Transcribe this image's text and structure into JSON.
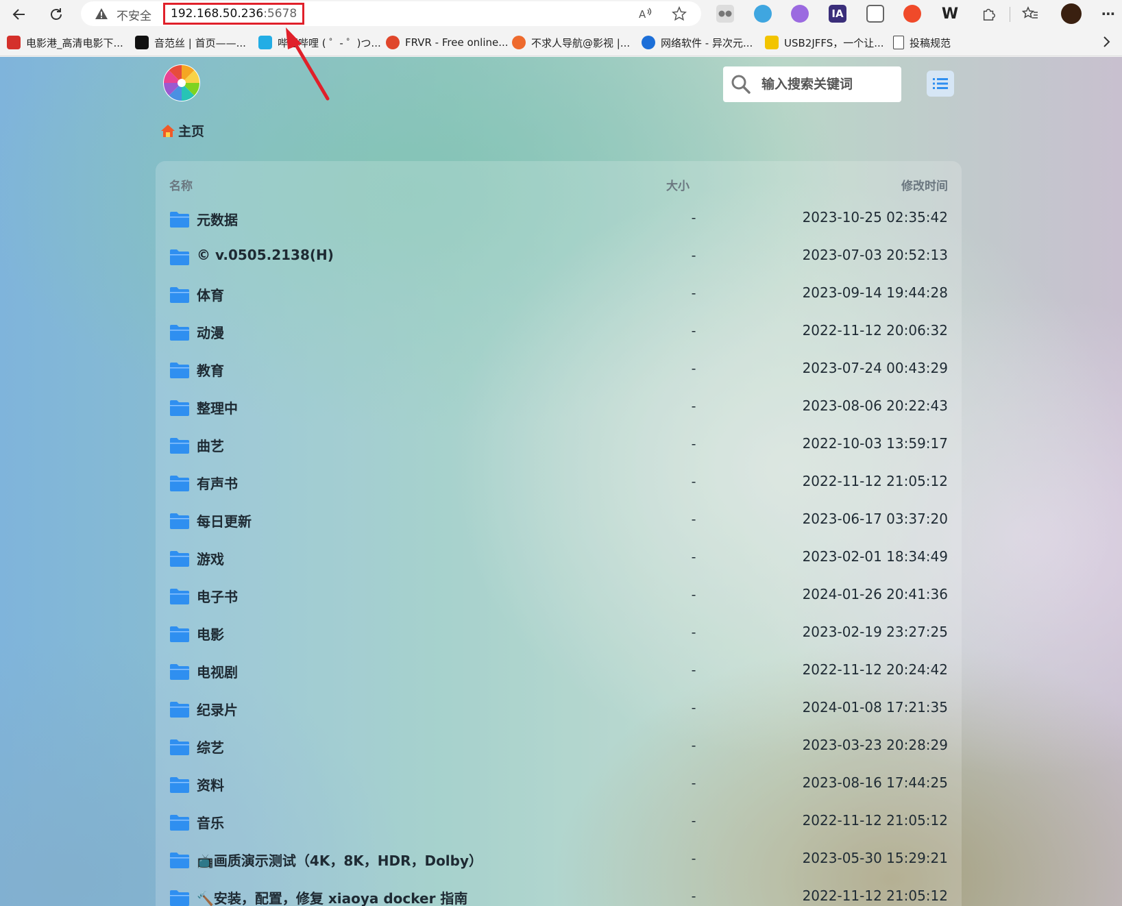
{
  "browser": {
    "security_label": "不安全",
    "url_host": "192.168.50.236",
    "url_port": ":5678",
    "bookmarks": [
      {
        "label": "电影港_高清电影下...",
        "icon": "movie-site-icon",
        "color": "#d4302b"
      },
      {
        "label": "音范丝 | 首页——...",
        "icon": "grid-logo-icon",
        "color": "#111111"
      },
      {
        "label": "哔哩哔哩 ( ゜- ゜)つ...",
        "icon": "bilibili-icon",
        "color": "#23ade5"
      },
      {
        "label": "FRVR - Free online...",
        "icon": "frvr-icon",
        "color": "#e0462b"
      },
      {
        "label": "不求人导航@影视 |...",
        "icon": "nav-site-icon",
        "color": "#ee6a2d"
      },
      {
        "label": "网络软件 - 异次元...",
        "icon": "software-site-icon",
        "color": "#1d6fd8"
      },
      {
        "label": "USB2JFFS，一个让...",
        "icon": "usb-site-icon",
        "color": "#f2c400"
      },
      {
        "label": "投稿规范",
        "icon": "document-icon",
        "color": "#444444"
      }
    ]
  },
  "page": {
    "search_placeholder": "输入搜索关键词",
    "breadcrumb": "主页",
    "columns": {
      "name": "名称",
      "size": "大小",
      "modified": "修改时间"
    },
    "rows": [
      {
        "name": "元数据",
        "size": "-",
        "modified": "2023-10-25 02:35:42"
      },
      {
        "name": "© v.0505.2138(H)",
        "size": "-",
        "modified": "2023-07-03 20:52:13"
      },
      {
        "name": "体育",
        "size": "-",
        "modified": "2023-09-14 19:44:28"
      },
      {
        "name": "动漫",
        "size": "-",
        "modified": "2022-11-12 20:06:32"
      },
      {
        "name": "教育",
        "size": "-",
        "modified": "2023-07-24 00:43:29"
      },
      {
        "name": "整理中",
        "size": "-",
        "modified": "2023-08-06 20:22:43"
      },
      {
        "name": "曲艺",
        "size": "-",
        "modified": "2022-10-03 13:59:17"
      },
      {
        "name": "有声书",
        "size": "-",
        "modified": "2022-11-12 21:05:12"
      },
      {
        "name": "每日更新",
        "size": "-",
        "modified": "2023-06-17 03:37:20"
      },
      {
        "name": "游戏",
        "size": "-",
        "modified": "2023-02-01 18:34:49"
      },
      {
        "name": "电子书",
        "size": "-",
        "modified": "2024-01-26 20:41:36"
      },
      {
        "name": "电影",
        "size": "-",
        "modified": "2023-02-19 23:27:25"
      },
      {
        "name": "电视剧",
        "size": "-",
        "modified": "2022-11-12 20:24:42"
      },
      {
        "name": "纪录片",
        "size": "-",
        "modified": "2024-01-08 17:21:35"
      },
      {
        "name": "综艺",
        "size": "-",
        "modified": "2023-03-23 20:28:29"
      },
      {
        "name": "资料",
        "size": "-",
        "modified": "2023-08-16 17:44:25"
      },
      {
        "name": "音乐",
        "size": "-",
        "modified": "2022-11-12 21:05:12"
      },
      {
        "name": "📺画质演示测试（4K，8K，HDR，Dolby）",
        "size": "-",
        "modified": "2023-05-30 15:29:21"
      },
      {
        "name": "🔨安装，配置，修复 xiaoya docker 指南",
        "size": "-",
        "modified": "2022-11-12 21:05:12"
      }
    ]
  },
  "colors": {
    "folder": "#2f8ff0",
    "annotation": "#e0202a"
  }
}
